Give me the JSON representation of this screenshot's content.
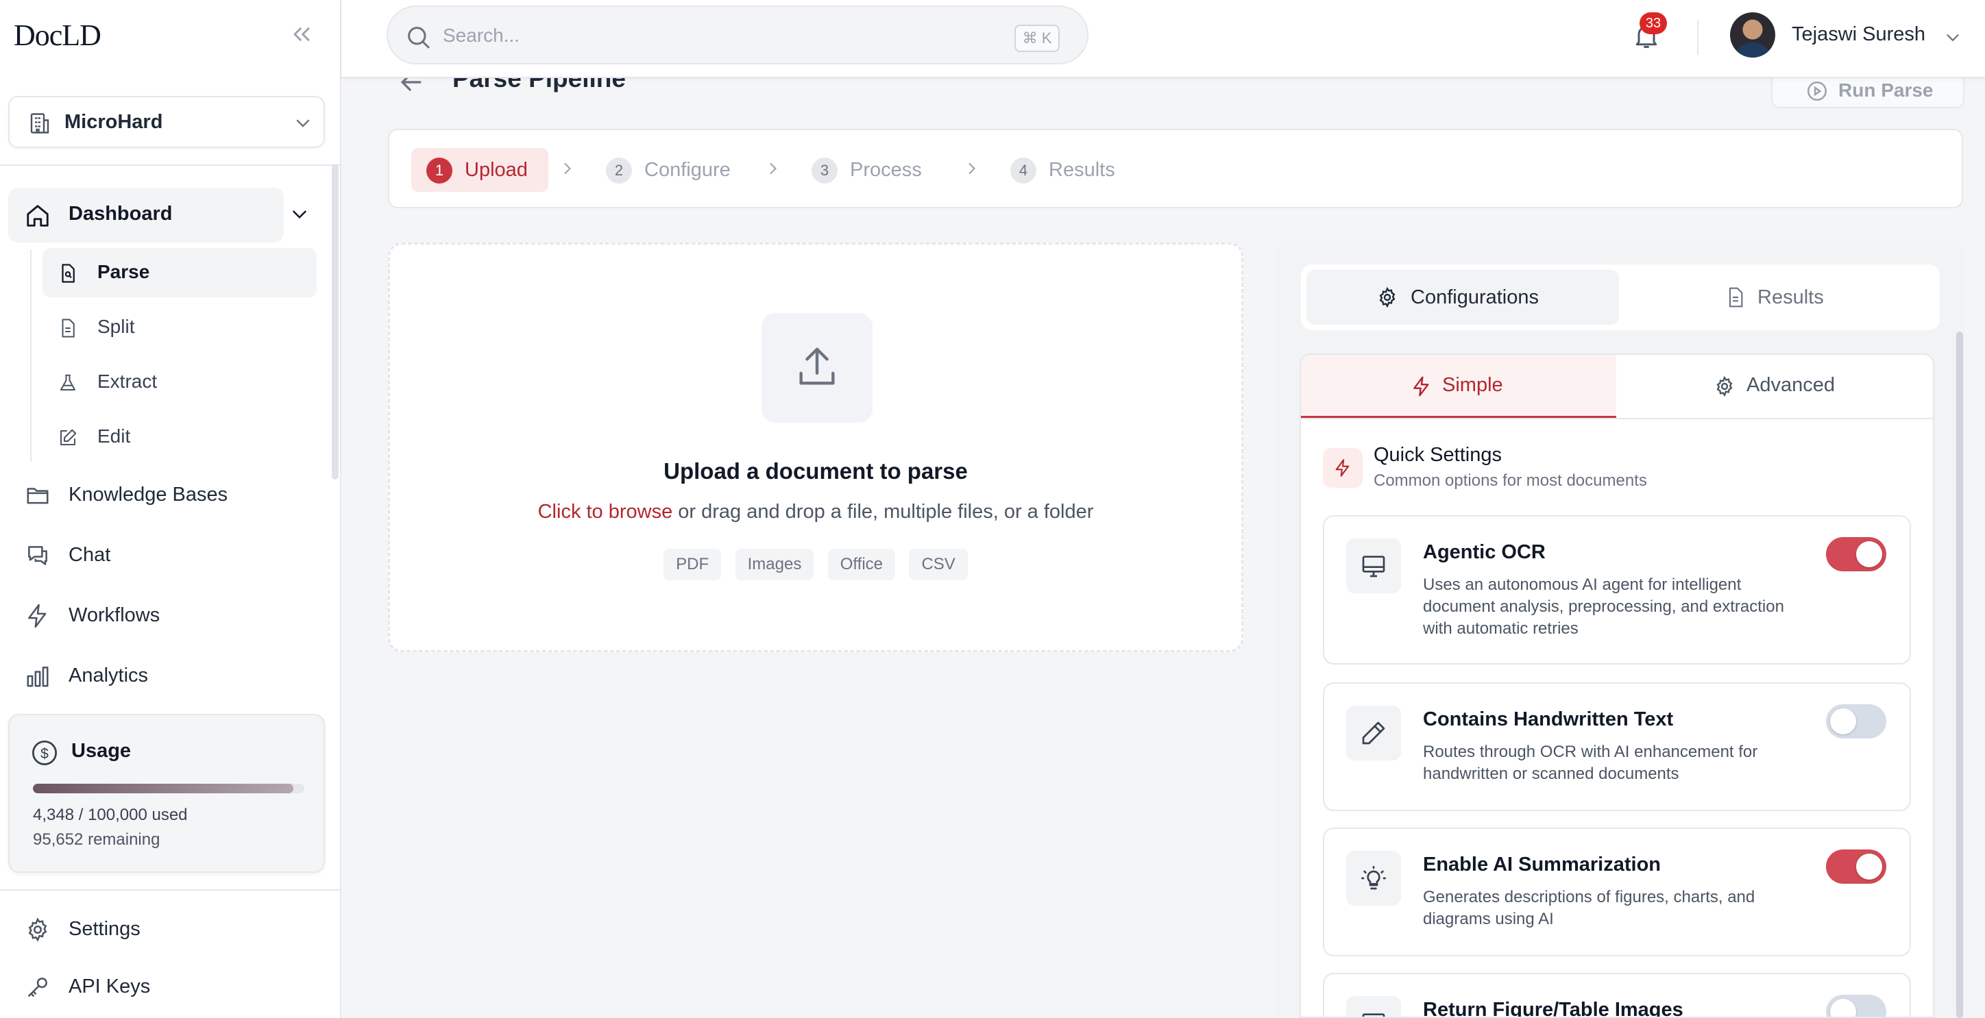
{
  "app": {
    "brand": "DocLD"
  },
  "sidebar": {
    "org_name": "MicroHard",
    "dashboard_label": "Dashboard",
    "sub_items": [
      {
        "label": "Parse",
        "icon": "file-scan-icon",
        "active": true
      },
      {
        "label": "Split",
        "icon": "file-icon",
        "active": false
      },
      {
        "label": "Extract",
        "icon": "flask-icon",
        "active": false
      },
      {
        "label": "Edit",
        "icon": "pencil-square-icon",
        "active": false
      }
    ],
    "items": [
      {
        "label": "Knowledge Bases",
        "icon": "folder-icon"
      },
      {
        "label": "Chat",
        "icon": "chat-bubbles-icon"
      },
      {
        "label": "Workflows",
        "icon": "lightning-icon"
      },
      {
        "label": "Analytics",
        "icon": "bar-chart-icon"
      }
    ],
    "usage": {
      "title": "Usage",
      "used_text": "4,348 / 100,000 used",
      "remaining_text": "95,652 remaining",
      "fraction_used": 0.96
    },
    "footer_items": [
      {
        "label": "Settings",
        "icon": "gear-icon"
      },
      {
        "label": "API Keys",
        "icon": "key-icon"
      }
    ]
  },
  "topbar": {
    "search_placeholder": "Search...",
    "shortcut": "⌘ K",
    "notification_count": "33",
    "user_name": "Tejaswi Suresh"
  },
  "page": {
    "title": "Parse Pipeline",
    "run_button": "Run Parse"
  },
  "steps": [
    {
      "num": "1",
      "label": "Upload",
      "active": true
    },
    {
      "num": "2",
      "label": "Configure",
      "active": false
    },
    {
      "num": "3",
      "label": "Process",
      "active": false
    },
    {
      "num": "4",
      "label": "Results",
      "active": false
    }
  ],
  "upload": {
    "title": "Upload a document to parse",
    "link_text": "Click to browse",
    "rest_text": " or drag and drop a file, multiple files, or a folder",
    "formats": [
      "PDF",
      "Images",
      "Office",
      "CSV"
    ]
  },
  "panel": {
    "tabs": [
      {
        "label": "Configurations",
        "active": true
      },
      {
        "label": "Results",
        "active": false
      }
    ],
    "modes": [
      {
        "label": "Simple",
        "active": true
      },
      {
        "label": "Advanced",
        "active": false
      }
    ],
    "quick_settings": {
      "title": "Quick Settings",
      "subtitle": "Common options for most documents"
    },
    "options": [
      {
        "title": "Agentic OCR",
        "desc": "Uses an autonomous AI agent for intelligent document analysis, preprocessing, and extraction with automatic retries",
        "enabled": true,
        "icon": "monitor-icon"
      },
      {
        "title": "Contains Handwritten Text",
        "desc": "Routes through OCR with AI enhancement for handwritten or scanned documents",
        "enabled": false,
        "icon": "pencil-icon"
      },
      {
        "title": "Enable AI Summarization",
        "desc": "Generates descriptions of figures, charts, and diagrams using AI",
        "enabled": true,
        "icon": "lightbulb-icon"
      },
      {
        "title": "Return Figure/Table Images",
        "desc": "",
        "enabled": false,
        "icon": "image-icon"
      }
    ]
  },
  "colors": {
    "accent": "#c9353e",
    "accent_soft": "#fbe8e8",
    "toggle_on": "#d14a55",
    "toggle_off": "#d6dde6"
  }
}
